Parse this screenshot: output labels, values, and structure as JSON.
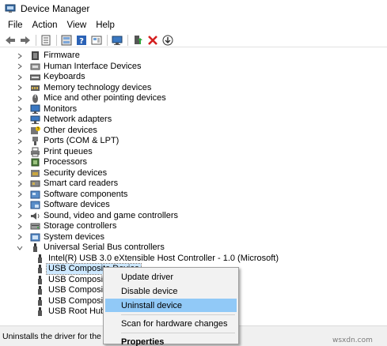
{
  "window": {
    "title": "Device Manager"
  },
  "menubar": {
    "items": [
      "File",
      "Action",
      "View",
      "Help"
    ]
  },
  "toolbar": {
    "buttons": [
      "back-icon",
      "forward-icon",
      "properties-icon",
      "update-driver-icon",
      "help-icon",
      "view-icon",
      "scan-hardware-icon",
      "enable-device-icon",
      "uninstall-icon",
      "download-icon"
    ]
  },
  "tree": {
    "categories": [
      {
        "label": "Firmware",
        "icon": "firmware-icon"
      },
      {
        "label": "Human Interface Devices",
        "icon": "hid-icon"
      },
      {
        "label": "Keyboards",
        "icon": "keyboard-icon"
      },
      {
        "label": "Memory technology devices",
        "icon": "memory-icon"
      },
      {
        "label": "Mice and other pointing devices",
        "icon": "mouse-icon"
      },
      {
        "label": "Monitors",
        "icon": "monitor-icon"
      },
      {
        "label": "Network adapters",
        "icon": "network-icon"
      },
      {
        "label": "Other devices",
        "icon": "other-device-icon"
      },
      {
        "label": "Ports (COM & LPT)",
        "icon": "port-icon"
      },
      {
        "label": "Print queues",
        "icon": "printer-icon"
      },
      {
        "label": "Processors",
        "icon": "processor-icon"
      },
      {
        "label": "Security devices",
        "icon": "security-icon"
      },
      {
        "label": "Smart card readers",
        "icon": "smartcard-icon"
      },
      {
        "label": "Software components",
        "icon": "software-component-icon"
      },
      {
        "label": "Software devices",
        "icon": "software-device-icon"
      },
      {
        "label": "Sound, video and game controllers",
        "icon": "sound-icon"
      },
      {
        "label": "Storage controllers",
        "icon": "storage-icon"
      },
      {
        "label": "System devices",
        "icon": "system-icon"
      },
      {
        "label": "Universal Serial Bus controllers",
        "icon": "usb-controller-icon",
        "expanded": true
      }
    ],
    "usb_children": [
      {
        "label": "Intel(R) USB 3.0 eXtensible Host Controller - 1.0 (Microsoft)",
        "selected": false
      },
      {
        "label": "USB Composite Device",
        "selected": true
      },
      {
        "label": "USB Composite Device",
        "selected": false
      },
      {
        "label": "USB Composite Device",
        "selected": false
      },
      {
        "label": "USB Composite Device",
        "selected": false
      },
      {
        "label": "USB Root Hub (USB 3.0)",
        "selected": false
      }
    ]
  },
  "context_menu": {
    "items": [
      {
        "label": "Update driver",
        "highlighted": false,
        "bold": false
      },
      {
        "label": "Disable device",
        "highlighted": false,
        "bold": false
      },
      {
        "label": "Uninstall device",
        "highlighted": true,
        "bold": false
      },
      {
        "separator": true
      },
      {
        "label": "Scan for hardware changes",
        "highlighted": false,
        "bold": false
      },
      {
        "separator": true
      },
      {
        "label": "Properties",
        "highlighted": false,
        "bold": true
      }
    ]
  },
  "statusbar": {
    "text": "Uninstalls the driver for the selected device."
  },
  "watermark": {
    "text": "wsxdn.com"
  },
  "colors": {
    "selection": "#cce8ff",
    "menu_highlight": "#91c9f7",
    "menu_background": "#f2f2f2",
    "statusbar": "#f0f0f0"
  }
}
